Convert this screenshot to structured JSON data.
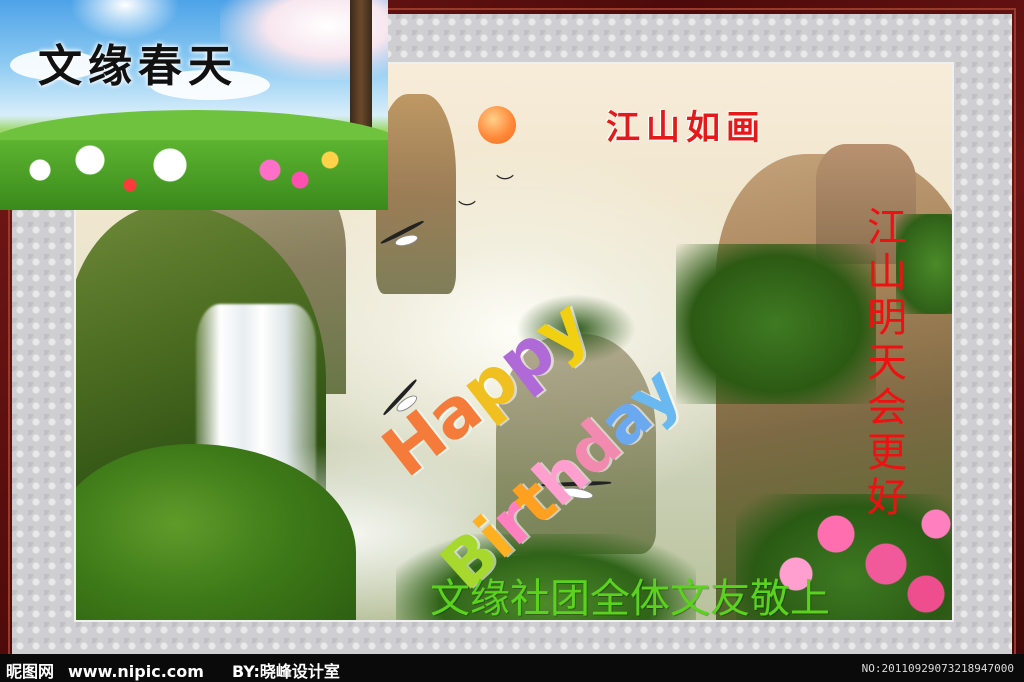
{
  "inset": {
    "title": "文缘春天"
  },
  "painting": {
    "title": "江山如画",
    "vertical_text": "江山明天会更好",
    "greeting_line1": "Happy",
    "greeting_line2": "Birthday",
    "bottom_text": "文缘社团全体文友敬上"
  },
  "footer": {
    "site_name": "昵图网",
    "site_url": "www.nipic.com",
    "credit": "BY:晓峰设计室",
    "image_no": "NO:20110929073218947000"
  },
  "colors": {
    "frame": "#5a0f0f",
    "title_red": "#e41a1a",
    "bottom_green": "#5ad21e",
    "happy": [
      "#f47b3a",
      "#f47b3a",
      "#f0c020",
      "#b06ad8",
      "#f0d010"
    ],
    "birthday": [
      "#a6d82e",
      "#ffb020",
      "#ff7fbf",
      "#ffa020",
      "#ff9fcf",
      "#f28ab0",
      "#6aa8f0",
      "#6ab8f0"
    ]
  }
}
